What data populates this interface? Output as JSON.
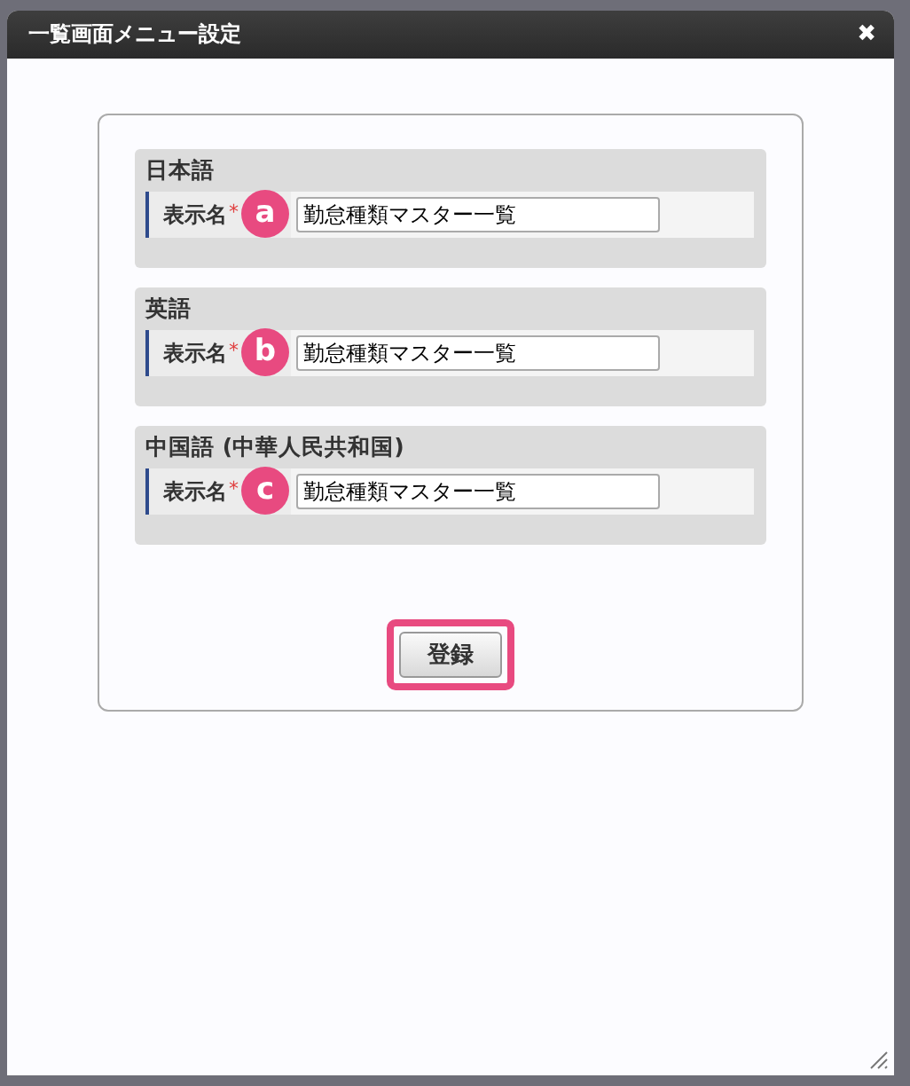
{
  "dialog": {
    "title": "一覧画面メニュー設定",
    "close_label": "✖"
  },
  "sections": [
    {
      "heading": "日本語",
      "field_label": "表示名",
      "required_mark": "*",
      "marker": "a",
      "value": "勤怠種類マスター一覧"
    },
    {
      "heading": "英語",
      "field_label": "表示名",
      "required_mark": "*",
      "marker": "b",
      "value": "勤怠種類マスター一覧"
    },
    {
      "heading": "中国語 (中華人民共和国)",
      "field_label": "表示名",
      "required_mark": "*",
      "marker": "c",
      "value": "勤怠種類マスター一覧"
    }
  ],
  "submit_button": {
    "label": "登録",
    "highlighted": true
  }
}
